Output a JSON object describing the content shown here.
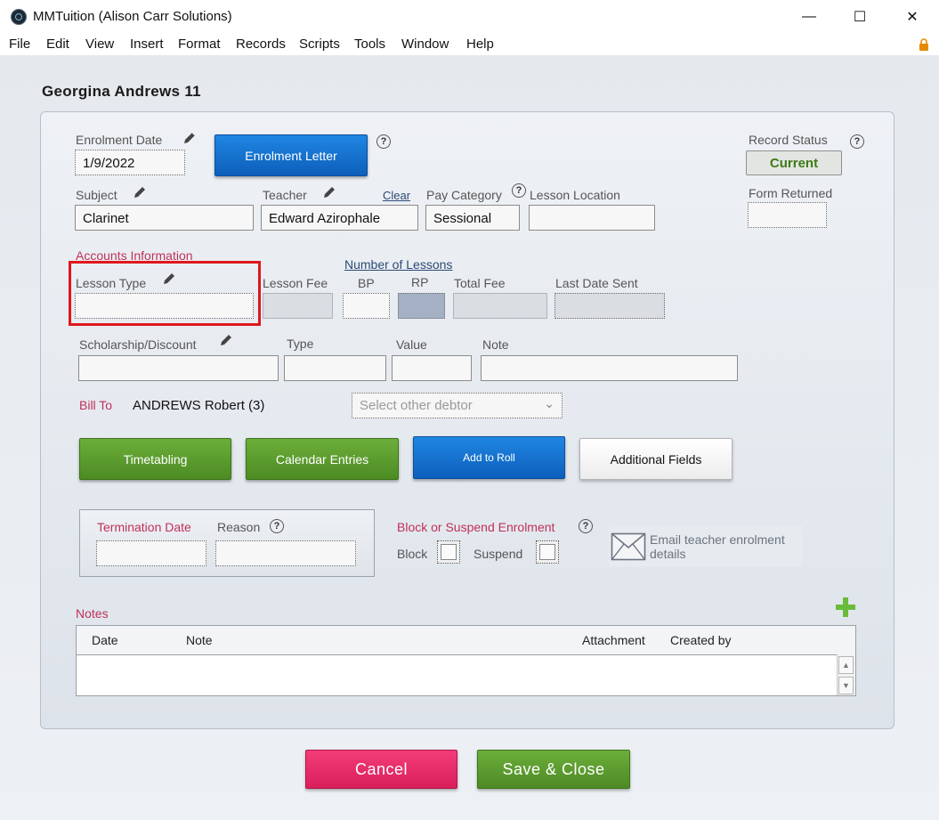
{
  "window": {
    "title": "MMTuition (Alison Carr Solutions)",
    "minimize": "—",
    "maximize": "☐",
    "close": "✕"
  },
  "menu": [
    "File",
    "Edit",
    "View",
    "Insert",
    "Format",
    "Records",
    "Scripts",
    "Tools",
    "Window",
    "Help"
  ],
  "record_title": "Georgina Andrews 11",
  "enrolment": {
    "enrolment_date_label": "Enrolment Date",
    "enrolment_date_value": "1/9/2022",
    "enrolment_letter_button": "Enrolment Letter",
    "record_status_label": "Record Status",
    "record_status_value": "Current",
    "subject_label": "Subject",
    "subject_value": "Clarinet",
    "teacher_label": "Teacher",
    "teacher_value": "Edward Azirophale",
    "clear_link": "Clear",
    "pay_category_label": "Pay Category",
    "pay_category_value": "Sessional",
    "lesson_location_label": "Lesson Location",
    "lesson_location_value": "",
    "form_returned_label": "Form Returned",
    "form_returned_value": ""
  },
  "accounts": {
    "section_label": "Accounts Information",
    "lesson_type_label": "Lesson Type",
    "lesson_type_value": "",
    "lesson_fee_label": "Lesson Fee",
    "number_of_lessons_label": "Number of Lessons",
    "bp_label": "BP",
    "rp_label": "RP",
    "total_fee_label": "Total Fee",
    "last_date_sent_label": "Last Date Sent",
    "scholarship_label": "Scholarship/Discount",
    "type_label": "Type",
    "value_label": "Value",
    "note_label": "Note",
    "bill_to_label": "Bill To",
    "bill_to_value": "ANDREWS Robert (3)",
    "debtor_placeholder": "Select other debtor"
  },
  "actions": {
    "timetabling": "Timetabling",
    "calendar_entries": "Calendar Entries",
    "add_to_roll": "Add to Roll",
    "additional_fields": "Additional Fields"
  },
  "termination": {
    "termination_date_label": "Termination Date",
    "reason_label": "Reason",
    "block_suspend_label": "Block or Suspend Enrolment",
    "block_label": "Block",
    "suspend_label": "Suspend",
    "email_teacher_label": "Email teacher enrolment details"
  },
  "notes": {
    "label": "Notes",
    "columns": [
      "Date",
      "Note",
      "Attachment",
      "Created by"
    ],
    "rows": []
  },
  "footer": {
    "cancel": "Cancel",
    "save_close": "Save & Close"
  },
  "icons": {
    "help": "?",
    "scroll_up": "▲",
    "scroll_down": "▼",
    "dropdown_chevron": "⌄"
  },
  "colors": {
    "accent_red": "#c0305a",
    "status_green": "#3e7a16",
    "highlight_box": "#e0161c"
  }
}
